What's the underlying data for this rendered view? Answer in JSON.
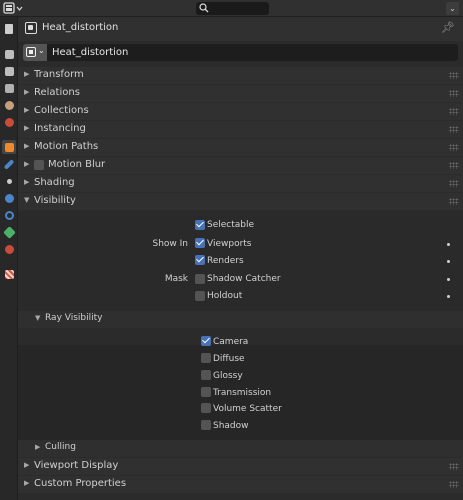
{
  "header": {
    "editor_icon": "properties-editor-icon",
    "search_icon": "search-icon"
  },
  "object": {
    "title": "Heat_distortion",
    "name_value": "Heat_distortion"
  },
  "sections": {
    "transform": "Transform",
    "relations": "Relations",
    "collections": "Collections",
    "instancing": "Instancing",
    "motion_paths": "Motion Paths",
    "motion_blur": "Motion Blur",
    "shading": "Shading",
    "visibility": "Visibility",
    "ray_visibility": "Ray Visibility",
    "culling": "Culling",
    "viewport_display": "Viewport Display",
    "custom_properties": "Custom Properties"
  },
  "visibility": {
    "selectable": "Selectable",
    "show_in_label": "Show In",
    "viewports": "Viewports",
    "renders": "Renders",
    "mask_label": "Mask",
    "shadow_catcher": "Shadow Catcher",
    "holdout": "Holdout"
  },
  "ray_visibility": {
    "camera": "Camera",
    "diffuse": "Diffuse",
    "glossy": "Glossy",
    "transmission": "Transmission",
    "volume_scatter": "Volume Scatter",
    "shadow": "Shadow"
  },
  "states": {
    "selectable": true,
    "viewports": true,
    "renders": true,
    "shadow_catcher": false,
    "holdout": false,
    "camera": true,
    "diffuse": false,
    "glossy": false,
    "transmission": false,
    "volume_scatter": false,
    "shadow": false,
    "motion_blur": false
  },
  "colors": {
    "accent": "#4772b3",
    "panel": "#2b2b2b",
    "header": "#303030"
  }
}
